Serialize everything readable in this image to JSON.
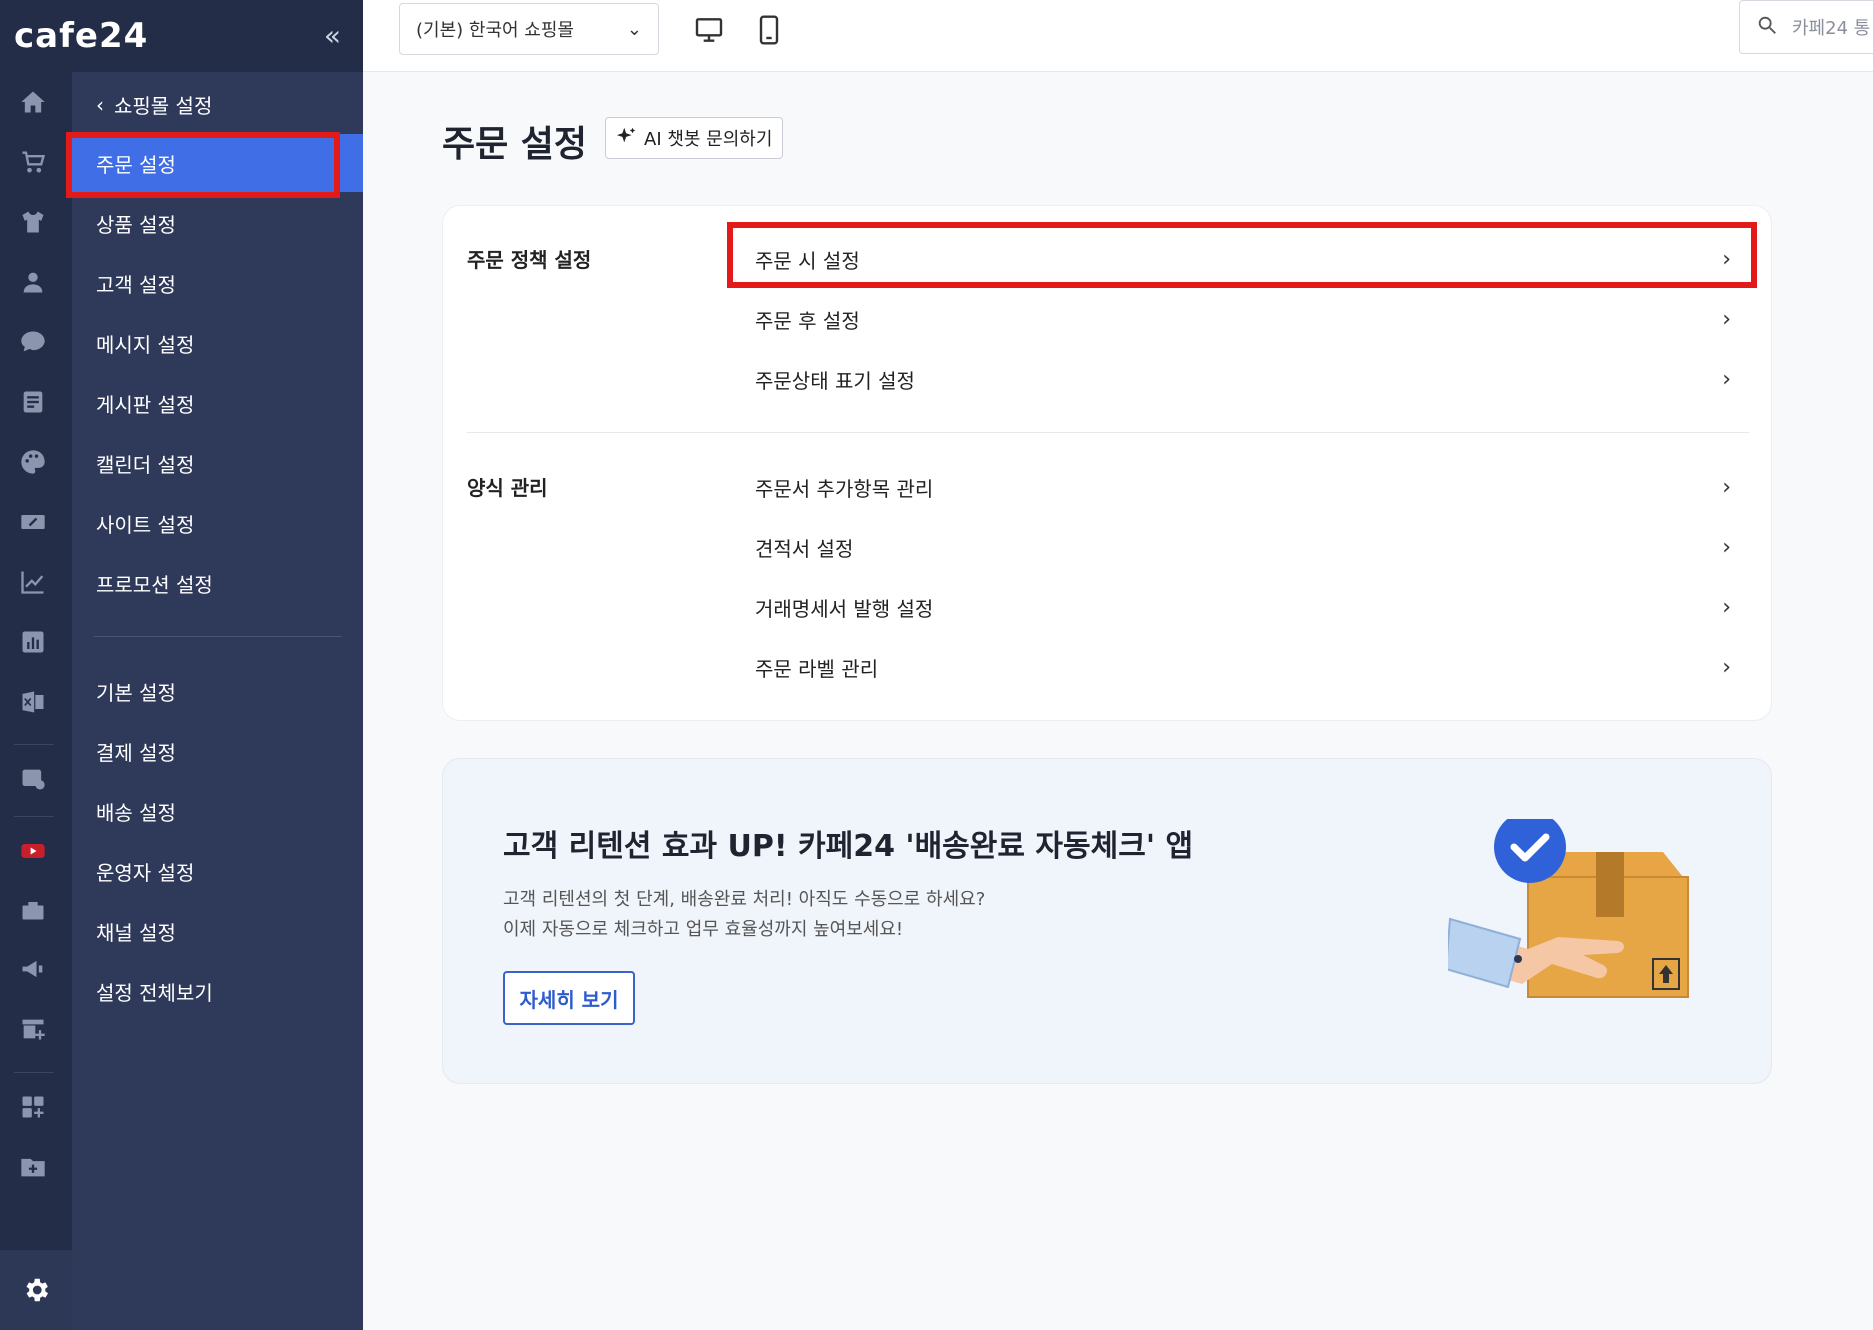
{
  "app": {
    "logo": "cafe24",
    "collapse_icon": "double-chevron-left-icon"
  },
  "rail": {
    "icons": [
      "home-icon",
      "cart-icon",
      "shirt-icon",
      "person-icon",
      "chat-icon",
      "board-icon",
      "palette-icon",
      "coupon-icon",
      "chart-line-icon",
      "stats-icon",
      "excel-icon",
      "plugin-icon",
      "youtube-icon",
      "store-icon",
      "megaphone-icon",
      "shop-add-icon",
      "apps-add-icon",
      "folder-add-icon",
      "gear-icon"
    ]
  },
  "subnav": {
    "back_label": "쇼핑몰 설정",
    "items": [
      "주문 설정",
      "상품 설정",
      "고객 설정",
      "메시지 설정",
      "게시판 설정",
      "캘린더 설정",
      "사이트 설정",
      "프로모션 설정"
    ],
    "items2": [
      "기본 설정",
      "결제 설정",
      "배송 설정",
      "운영자 설정",
      "채널 설정",
      "설정 전체보기"
    ],
    "active": "주문 설정"
  },
  "topbar": {
    "shop_select_value": "(기본) 한국어 쇼핑몰",
    "search_placeholder": "카페24 통"
  },
  "page": {
    "title": "주문 설정",
    "ai_button": "AI 챗봇 문의하기"
  },
  "sections": [
    {
      "label": "주문 정책 설정",
      "rows": [
        "주문 시 설정",
        "주문 후 설정",
        "주문상태 표기 설정"
      ]
    },
    {
      "label": "양식 관리",
      "rows": [
        "주문서 추가항목 관리",
        "견적서 설정",
        "거래명세서 발행 설정",
        "주문 라벨 관리"
      ]
    }
  ],
  "banner": {
    "title": "고객 리텐션 효과 UP! 카페24 '배송완료 자동체크' 앱",
    "desc_line1": "고객 리텐션의 첫 단계, 배송완료 처리! 아직도 수동으로 하세요?",
    "desc_line2": "이제 자동으로 체크하고 업무 효율성까지 높여보세요!",
    "button": "자세히 보기"
  },
  "colors": {
    "sidebar_dark": "#232d47",
    "sidebar": "#2f3a5b",
    "active": "#3f6ee6",
    "highlight": "#e31a1a",
    "link": "#2f5bd0"
  }
}
